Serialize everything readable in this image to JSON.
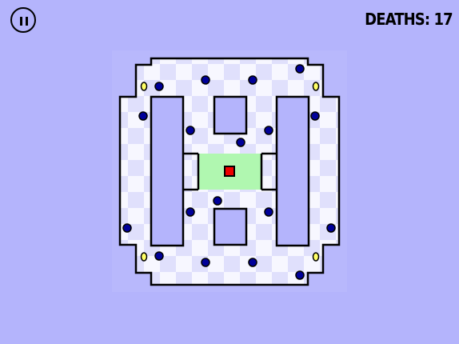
{
  "hud": {
    "deaths_label": "DEATHS:",
    "deaths_count": "17",
    "pause_icon": "pause-icon"
  },
  "colors": {
    "background": "#b4b4fc",
    "tile_light": "#f7f7ff",
    "tile_dark": "#e0e0fc",
    "safe_zone": "#b0f7b0",
    "player_fill": "#ee0000",
    "enemy_fill": "#000099",
    "coin_fill": "#ffff66",
    "wall_stroke": "#000000"
  },
  "game": {
    "level_type": "worlds-hardest-game-style maze",
    "player": "red-square",
    "enemies_count": 22,
    "coins_count": 4
  }
}
